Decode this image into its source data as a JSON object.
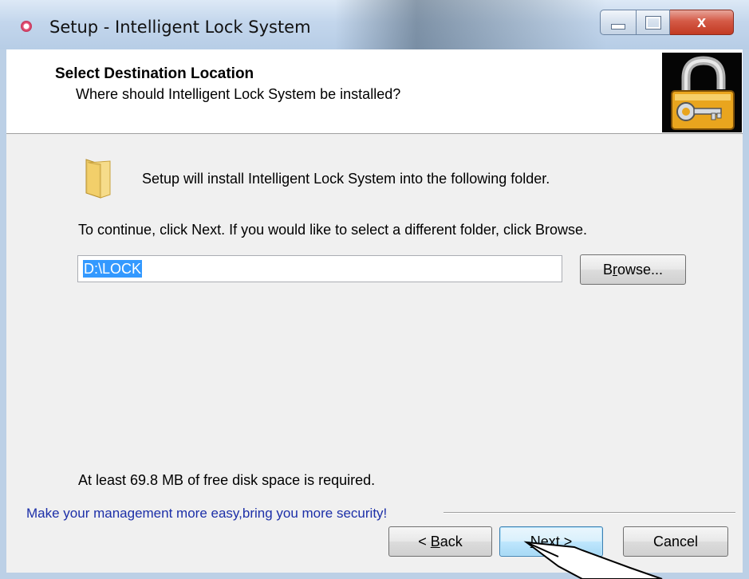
{
  "window": {
    "title": "Setup - Intelligent Lock System",
    "close_glyph": "x"
  },
  "header": {
    "title": "Select Destination Location",
    "subtitle": "Where should Intelligent Lock System be installed?"
  },
  "body": {
    "intro": "Setup will install Intelligent Lock System into the following folder.",
    "instruction": "To continue, click Next. If you would like to select a different folder, click Browse.",
    "path_value": "D:\\LOCK",
    "browse_label_pre": "B",
    "browse_label_ul": "r",
    "browse_label_post": "owse...",
    "disk_space": "At least 69.8 MB of free disk space is required."
  },
  "footer": {
    "tagline": "Make your management more easy,bring you more security!",
    "back_pre": "< ",
    "back_ul": "B",
    "back_post": "ack",
    "next_pre": "",
    "next_ul": "N",
    "next_post": "ext >",
    "cancel_label": "Cancel"
  },
  "colors": {
    "tagline": "#1c2fa8",
    "selection": "#3399ff",
    "close_button": "#c23a22"
  }
}
